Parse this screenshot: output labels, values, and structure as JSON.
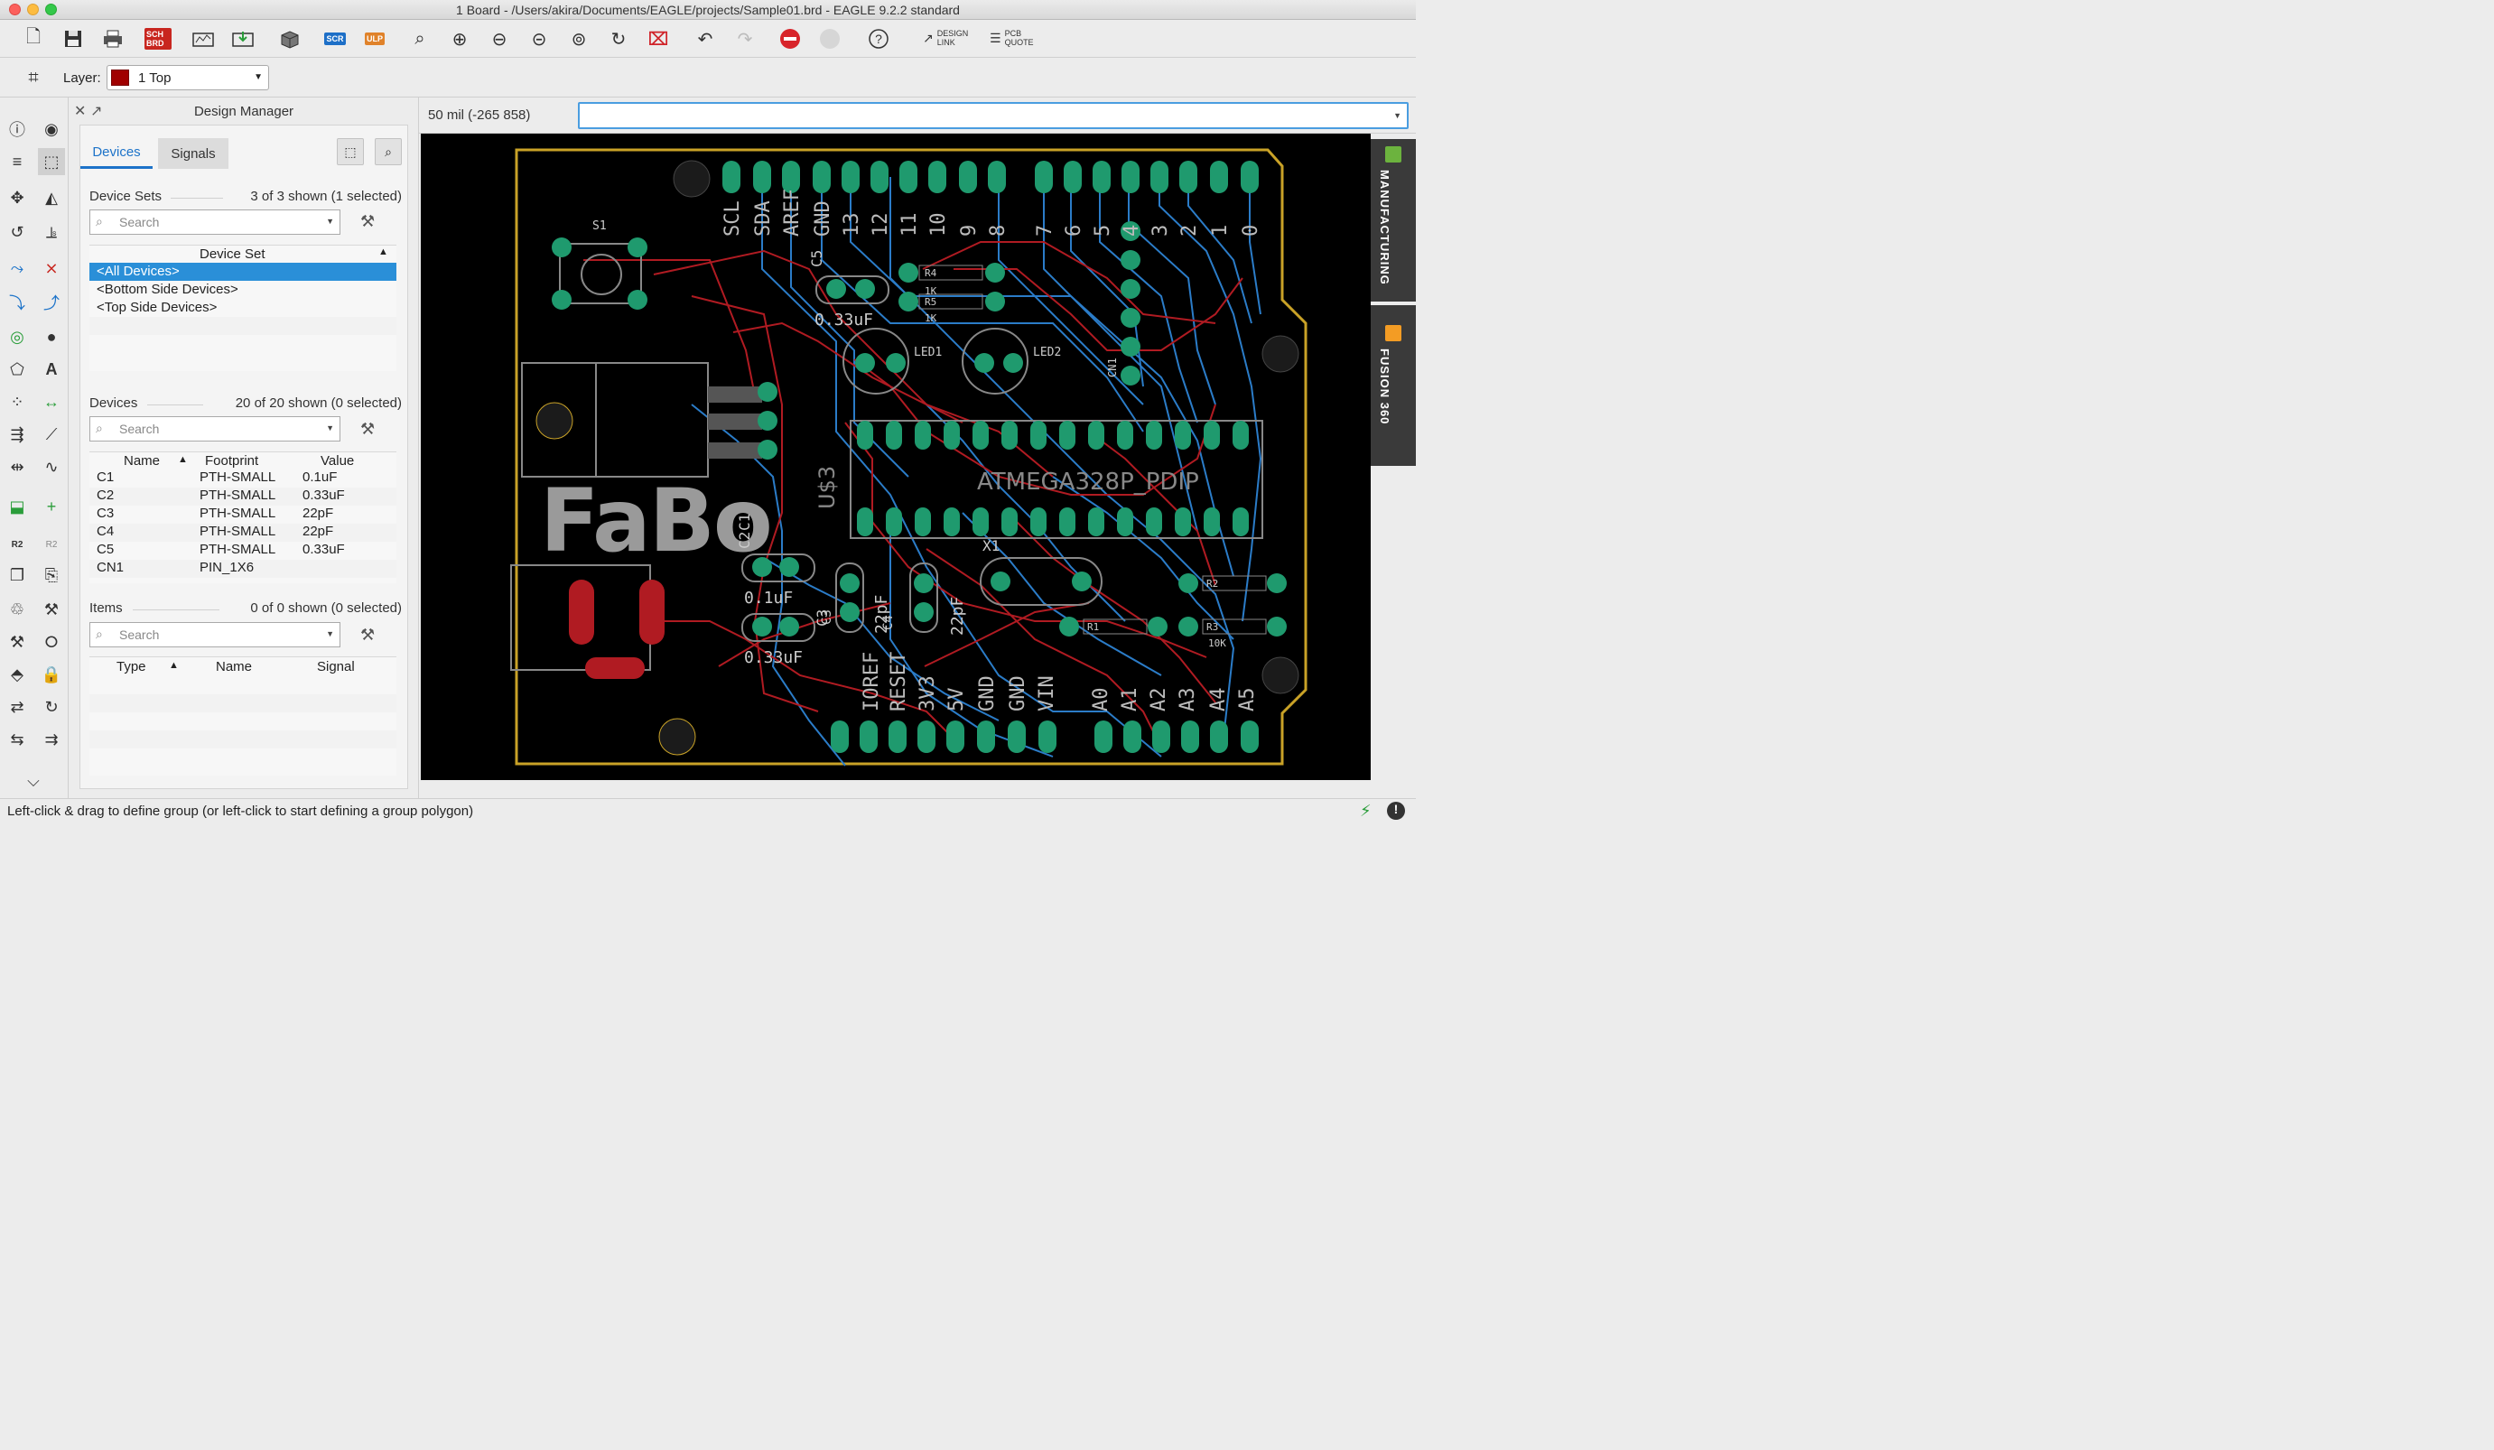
{
  "window": {
    "title": "1 Board - /Users/akira/Documents/EAGLE/projects/Sample01.brd - EAGLE 9.2.2 standard"
  },
  "toolbar": {
    "sch_brd_label": "SCH BRD",
    "scr_label": "SCR",
    "ulp_label": "ULP",
    "design_link_label": "DESIGN LINK",
    "pcb_quote_label": "PCB QUOTE"
  },
  "layer": {
    "label": "Layer:",
    "value": "1 Top",
    "color": "#a00000"
  },
  "design_manager": {
    "title": "Design Manager",
    "tabs": [
      "Devices",
      "Signals"
    ],
    "device_sets": {
      "title": "Device Sets",
      "count": "3 of 3 shown (1 selected)",
      "search_placeholder": "Search",
      "column": "Device Set",
      "items": [
        "<All Devices>",
        "<Bottom Side Devices>",
        "<Top Side Devices>"
      ]
    },
    "devices": {
      "title": "Devices",
      "count": "20 of 20 shown (0 selected)",
      "search_placeholder": "Search",
      "columns": [
        "Name",
        "Footprint",
        "Value"
      ],
      "rows": [
        {
          "name": "C1",
          "footprint": "PTH-SMALL",
          "value": "0.1uF"
        },
        {
          "name": "C2",
          "footprint": "PTH-SMALL",
          "value": "0.33uF"
        },
        {
          "name": "C3",
          "footprint": "PTH-SMALL",
          "value": "22pF"
        },
        {
          "name": "C4",
          "footprint": "PTH-SMALL",
          "value": "22pF"
        },
        {
          "name": "C5",
          "footprint": "PTH-SMALL",
          "value": "0.33uF"
        },
        {
          "name": "CN1",
          "footprint": "PIN_1X6",
          "value": ""
        }
      ]
    },
    "items": {
      "title": "Items",
      "count": "0 of 0 shown (0 selected)",
      "search_placeholder": "Search",
      "columns": [
        "Type",
        "Name",
        "Signal"
      ]
    }
  },
  "coord": {
    "text": "50 mil (-265 858)"
  },
  "right_tabs": [
    "MANUFACTURING",
    "FUSION 360"
  ],
  "status": {
    "text": "Left-click & drag to define group (or left-click to start defining a group polygon)"
  },
  "board": {
    "logo": "FaBo",
    "chip_label": "ATMEGA328P_PDIP",
    "chip_ref": "U$3",
    "top_header_labels": [
      "SCL",
      "SDA",
      "AREF",
      "GND",
      "13",
      "12",
      "11",
      "10",
      "9",
      "8",
      "7",
      "6",
      "5",
      "4",
      "3",
      "2",
      "1",
      "0"
    ],
    "bottom_header_labels": [
      "IOREF",
      "RESET",
      "3V3",
      "5V",
      "GND",
      "GND",
      "VIN",
      "A0",
      "A1",
      "A2",
      "A3",
      "A4",
      "A5"
    ],
    "part_labels": [
      "S1",
      "C5",
      "0.33uF",
      "R4",
      "1K",
      "R5",
      "1K",
      "LED1",
      "LED2",
      "CN1",
      "X1",
      "C1",
      "C2",
      "0.1uF",
      "0.33uF",
      "C3",
      "C4",
      "22pF",
      "22pF",
      "R2",
      "R1",
      "R3",
      "10K",
      "C3"
    ]
  }
}
